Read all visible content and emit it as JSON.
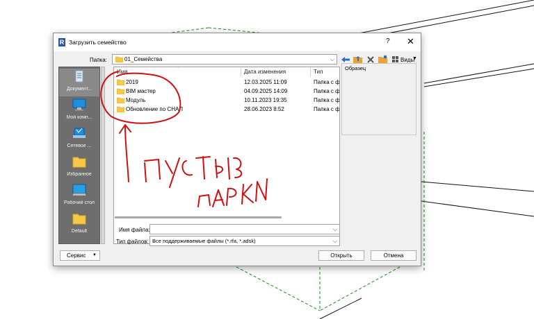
{
  "dialog": {
    "app_icon_letter": "R",
    "title": "Загрузить семейство",
    "help": "?",
    "close": "✕",
    "folder_label": "Папка:",
    "current_folder": "01_Семейства",
    "views_label": "Виды",
    "places": [
      {
        "label": "Документ...",
        "icon": "document-icon"
      },
      {
        "label": "Мой комп...",
        "icon": "computer-icon"
      },
      {
        "label": "Сетевое ...",
        "icon": "network-icon"
      },
      {
        "label": "Избранное",
        "icon": "folder-icon"
      },
      {
        "label": "Рабочий стол",
        "icon": "desktop-icon"
      },
      {
        "label": "Default",
        "icon": "folder-icon"
      }
    ],
    "columns": {
      "name": "Имя",
      "date": "Дата изменения",
      "type": "Тип"
    },
    "files": [
      {
        "name": "2019",
        "date": "12.03.2025 11:09",
        "type": "Папка с ф"
      },
      {
        "name": "BIM мастер",
        "date": "04.09.2025 14:09",
        "type": "Папка с ф"
      },
      {
        "name": "Модуль",
        "date": "10.11.2023 19:35",
        "type": "Папка с ф"
      },
      {
        "name": "Обновление по СНАП",
        "date": "28.06.2023 8:52",
        "type": "Папка с ф"
      }
    ],
    "preview_label": "Образец",
    "filename_label": "Имя файла:",
    "filename_value": "",
    "filetype_label": "Тип файлов:",
    "filetype_value": "Все поддерживаемые файлы  (*.rfa, *.adsk)",
    "service_button": "Сервис",
    "open_button": "Открыть",
    "cancel_button": "Отмена"
  },
  "annotation": {
    "line1": "ПУСТЫЕ",
    "line2": "ПАПКИ",
    "color": "#d01010"
  }
}
